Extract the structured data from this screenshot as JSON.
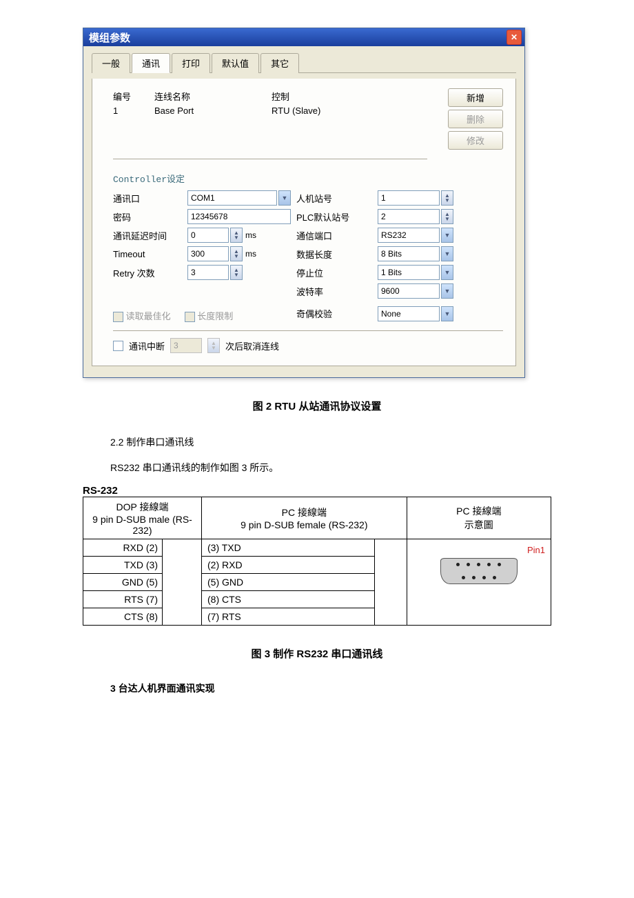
{
  "dialog": {
    "title": "模组参数",
    "tabs": [
      "一般",
      "通讯",
      "打印",
      "默认值",
      "其它"
    ],
    "active_tab": 1,
    "list": {
      "headers": {
        "num": "编号",
        "name": "连线名称",
        "ctrl": "控制"
      },
      "rows": [
        {
          "num": "1",
          "name": "Base Port",
          "ctrl": "RTU (Slave)"
        }
      ]
    },
    "buttons": {
      "add": "新增",
      "delete": "删除",
      "edit": "修改"
    },
    "section_title": "Controller设定",
    "left_labels": {
      "port": "通讯口",
      "password": "密码",
      "delay": "通讯延迟时间",
      "timeout": "Timeout",
      "retry": "Retry 次数"
    },
    "left_values": {
      "port": "COM1",
      "password": "12345678",
      "delay": "0",
      "timeout": "300",
      "retry": "3",
      "unit": "ms"
    },
    "right_labels": {
      "hmi": "人机站号",
      "plc": "PLC默认站号",
      "comm_port": "通信端口",
      "data_len": "数据长度",
      "stop_bit": "停止位",
      "baud": "波特率",
      "parity": "奇偶校验"
    },
    "right_values": {
      "hmi": "1",
      "plc": "2",
      "comm_port": "RS232",
      "data_len": "8 Bits",
      "stop_bit": "1 Bits",
      "baud": "9600",
      "parity": "None"
    },
    "checks": {
      "opt_read": "读取最佳化",
      "len_limit": "长度限制"
    },
    "bottom": {
      "interrupt": "通讯中断",
      "count": "3",
      "cancel_after": "次后取消连线"
    }
  },
  "captions": {
    "fig2": "图 2 RTU 从站通讯协议设置",
    "sec22": "2.2  制作串口通讯线",
    "para22": "RS232 串口通讯线的制作如图 3 所示。",
    "rs232": "RS-232",
    "fig3": "图 3  制作 RS232 串口通讯线",
    "sec3": "3 台达人机界面通讯实现"
  },
  "pinout": {
    "headers": {
      "dop_top": "DOP 接線端",
      "dop_sub": "9 pin D-SUB male (RS-232)",
      "pc_top": "PC 接線端",
      "pc_sub": "9 pin D-SUB female (RS-232)",
      "pc2_top": "PC 接線端",
      "pc2_sub": "示意圖"
    },
    "rows": [
      {
        "dop": "RXD (2)",
        "pc": "(3) TXD"
      },
      {
        "dop": "TXD (3)",
        "pc": "(2) RXD"
      },
      {
        "dop": "GND (5)",
        "pc": "(5) GND"
      },
      {
        "dop": "RTS (7)",
        "pc": "(8) CTS"
      },
      {
        "dop": "CTS (8)",
        "pc": "(7) RTS"
      }
    ],
    "pin1": "Pin1"
  }
}
